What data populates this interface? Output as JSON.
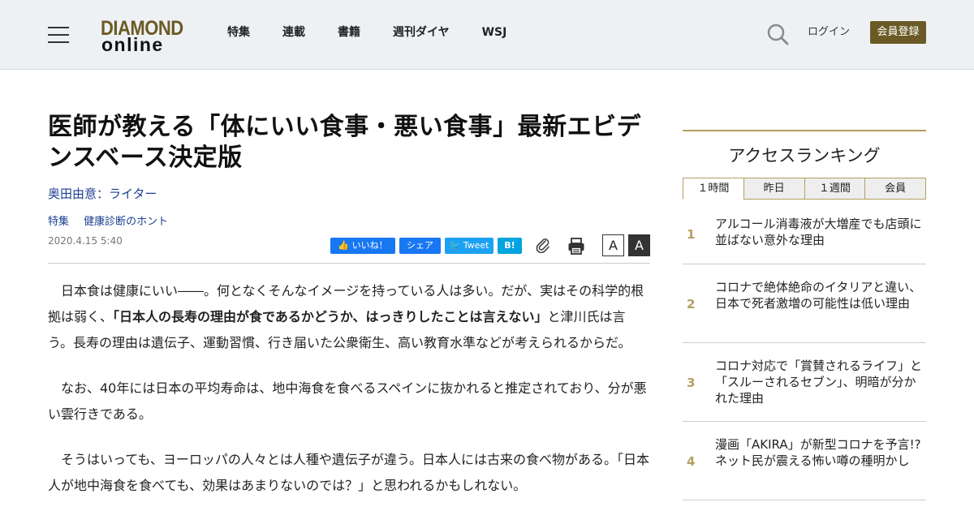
{
  "header": {
    "logo_top": "DIAMOND",
    "logo_bottom": "online",
    "nav": [
      "特集",
      "連載",
      "書籍",
      "週刊ダイヤ",
      "WSJ"
    ],
    "login": "ログイン",
    "register": "会員登録"
  },
  "article": {
    "title": "医師が教える「体にいい食事・悪い食事」最新エビデンスベース決定版",
    "author": "奥田由意：ライター",
    "tags": [
      "特集",
      "健康診断のホント"
    ],
    "date": "2020.4.15 5:40",
    "share": {
      "like": "いいね！",
      "share": "シェア",
      "tweet": "Tweet",
      "hatena": "B!"
    },
    "font_small": "A",
    "font_large": "A",
    "paragraphs": [
      {
        "before": "日本食は健康にいい――。何となくそんなイメージを持っている人は多い。だが、実はその科学的根拠は弱く、",
        "bold": "「日本人の長寿の理由が食であるかどうか、はっきりしたことは言えない」",
        "after": "と津川氏は言う。長寿の理由は遺伝子、運動習慣、行き届いた公衆衛生、高い教育水準などが考えられるからだ。"
      },
      {
        "before": "なお、40年には日本の平均寿命は、地中海食を食べるスペインに抜かれると推定されており、分が悪い雲行きである。",
        "bold": "",
        "after": ""
      },
      {
        "before": "そうはいっても、ヨーロッパの人々とは人種や遺伝子が違う。日本人には古来の食べ物がある。「日本人が地中海食を食べても、効果はあまりないのでは？」と思われるかもしれない。",
        "bold": "",
        "after": ""
      }
    ]
  },
  "sidebar": {
    "title": "アクセスランキング",
    "tabs": [
      "１時間",
      "昨日",
      "１週間",
      "会員"
    ],
    "active_tab": 0,
    "ranking": [
      {
        "rank": "1",
        "text": "アルコール消毒液が大増産でも店頭に並ばない意外な理由"
      },
      {
        "rank": "2",
        "text": "コロナで絶体絶命のイタリアと違い、日本で死者激増の可能性は低い理由"
      },
      {
        "rank": "3",
        "text": "コロナ対応で「賞賛されるライフ」と「スルーされるセブン」、明暗が分かれた理由"
      },
      {
        "rank": "4",
        "text": "漫画「AKIRA」が新型コロナを予言!?ネット民が震える怖い噂の種明かし"
      }
    ]
  },
  "colors": {
    "brand": "#6b5a25",
    "accent_gold": "#b59e63",
    "link_blue": "#1b3f8f",
    "facebook": "#1877f2",
    "twitter": "#1da1f2",
    "hatena": "#00a4de"
  }
}
